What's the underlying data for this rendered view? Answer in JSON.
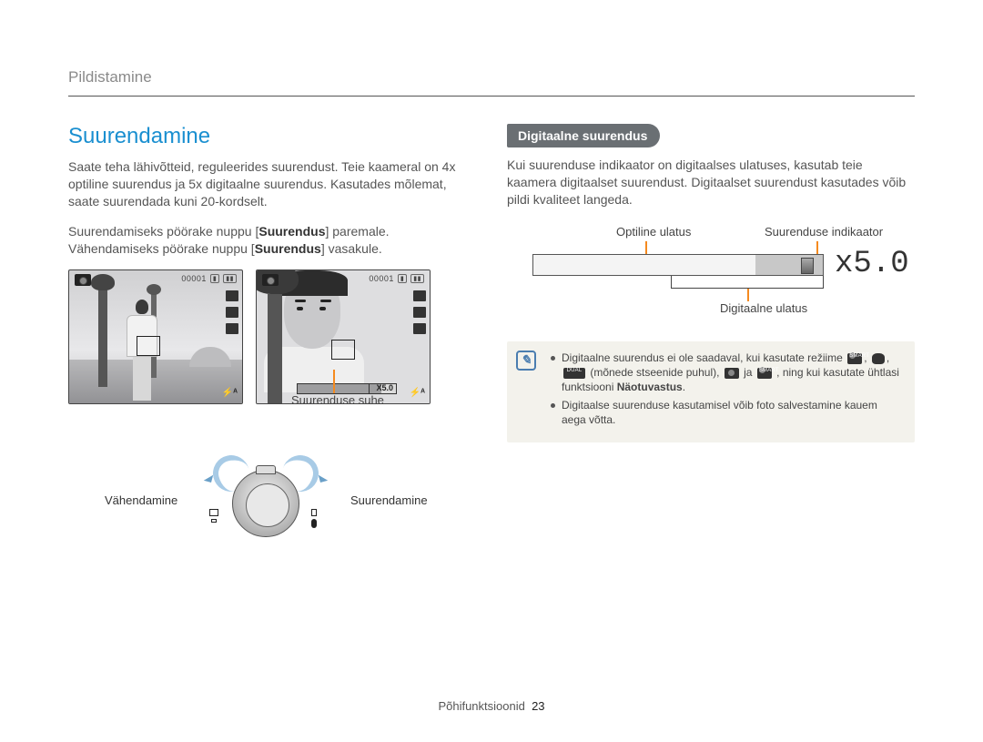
{
  "breadcrumb": "Pildistamine",
  "section_title": "Suurendamine",
  "left": {
    "p1": "Saate teha lähivõtteid, reguleerides suurendust. Teie kaameral on 4x optiline suurendus ja 5x digitaalne suurendus. Kasutades mõlemat, saate suurendada kuni 20-kordselt.",
    "p2_a": "Suurendamiseks pöörake nuppu [",
    "p2_b": "Suurendus",
    "p2_c": "] paremale. Vähendamiseks pöörake nuppu [",
    "p2_d": "Suurendus",
    "p2_e": "] vasakule.",
    "lcd_counter": "00001",
    "lcd_flash": "⚡ᴬ",
    "lcd_zoom_txt": "X5.0",
    "callout_ratio": "Suurenduse suhe",
    "dial_left": "Vähendamine",
    "dial_right": "Suurendamine"
  },
  "right": {
    "heading": "Digitaalne suurendus",
    "p1": "Kui suurenduse indikaator on digitaalses ulatuses, kasutab teie kaamera digitaalset suurendust. Digitaalset suurendust kasutades võib pildi kvaliteet langeda.",
    "label_optical": "Optiline ulatus",
    "label_indicator": "Suurenduse indikaator",
    "label_digital": "Digitaalne ulatus",
    "mag_text": "x5.0",
    "note1_a": "Digitaalne suurendus ei ole saadaval, kui kasutate režiime ",
    "note1_b": " (mõnede stseenide puhul), ",
    "note1_c": " ja ",
    "note1_d": ", ning kui kasutate ühtlasi funktsiooni ",
    "note1_e": "Näotuvastus",
    "note1_f": ".",
    "note2": "Digitaalse suurenduse kasutamisel võib foto salvestamine kauem aega võtta."
  },
  "footer": {
    "label": "Põhifunktsioonid",
    "page": "23"
  },
  "icon_texts": {
    "smart": "SMART",
    "dual": "DUAL"
  }
}
